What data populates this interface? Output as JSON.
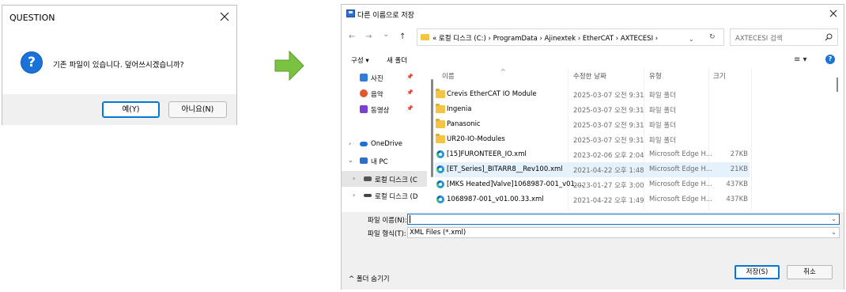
{
  "question_dialog": {
    "title": "QUESTION",
    "message": "기존 파일이 있습니다. 덮어쓰시겠습니까?",
    "yes_label": "예(Y)",
    "no_label": "아니요(N)",
    "icon": "question-icon",
    "accent_color": "#1a73d9"
  },
  "arrow": {
    "icon": "right-arrow-icon",
    "color": "#7cc242"
  },
  "save_dialog": {
    "title": "다른 이름으로 저장",
    "nav": {
      "back": "←",
      "forward": "→",
      "recent": "⌄",
      "up": "↑"
    },
    "address": "« 로컬 디스크 (C:)  ›  ProgramData  ›  Ajinextek  ›  EtherCAT  ›  AXTECESI  ›",
    "search_placeholder": "AXTECESI 검색",
    "toolbar": {
      "organize": "구성 ▾",
      "new_folder": "새 폴더"
    },
    "tree": [
      {
        "label": "사진"
      },
      {
        "label": "음악"
      },
      {
        "label": "동영상"
      },
      {
        "label": "OneDrive"
      },
      {
        "label": "내 PC"
      },
      {
        "label": "로컬 디스크 (C"
      },
      {
        "label": "로컬 디스크 (D"
      }
    ],
    "columns": {
      "name": "이름",
      "date": "수정한 날짜",
      "type": "유형",
      "size": "크기"
    },
    "files": [
      {
        "name": "Crevis EtherCAT IO Module",
        "date": "2025-03-07 오전 9:31",
        "type": "파일 폴더",
        "size": "",
        "kind": "folder"
      },
      {
        "name": "Ingenia",
        "date": "2025-03-07 오전 9:31",
        "type": "파일 폴더",
        "size": "",
        "kind": "folder"
      },
      {
        "name": "Panasonic",
        "date": "2025-03-07 오전 9:31",
        "type": "파일 폴더",
        "size": "",
        "kind": "folder"
      },
      {
        "name": "UR20-IO-Modules",
        "date": "2025-03-07 오전 9:31",
        "type": "파일 폴더",
        "size": "",
        "kind": "folder"
      },
      {
        "name": "[15]FURONTEER_IO.xml",
        "date": "2023-02-06 오후 2:04",
        "type": "Microsoft Edge H...",
        "size": "27KB",
        "kind": "edge"
      },
      {
        "name": "[ET_Series]_BITARR8__Rev100.xml",
        "date": "2021-04-22 오후 1:48",
        "type": "Microsoft Edge H...",
        "size": "21KB",
        "kind": "edge"
      },
      {
        "name": "[MKS Heated]Valve]1068987-001_v01....",
        "date": "2023-01-27 오후 3:00",
        "type": "Microsoft Edge H...",
        "size": "437KB",
        "kind": "edge"
      },
      {
        "name": "1068987-001_v01.00.33.xml",
        "date": "2021-04-22 오후 1:49",
        "type": "Microsoft Edge H...",
        "size": "437KB",
        "kind": "edge"
      }
    ],
    "filename_label": "파일 이름(N):",
    "filename_value": "",
    "filetype_label": "파일 형식(T):",
    "filetype_value": "XML Files (*.xml)",
    "hide_folders": "^  폴더 숨기기",
    "save_label": "저장(S)",
    "cancel_label": "취소"
  }
}
